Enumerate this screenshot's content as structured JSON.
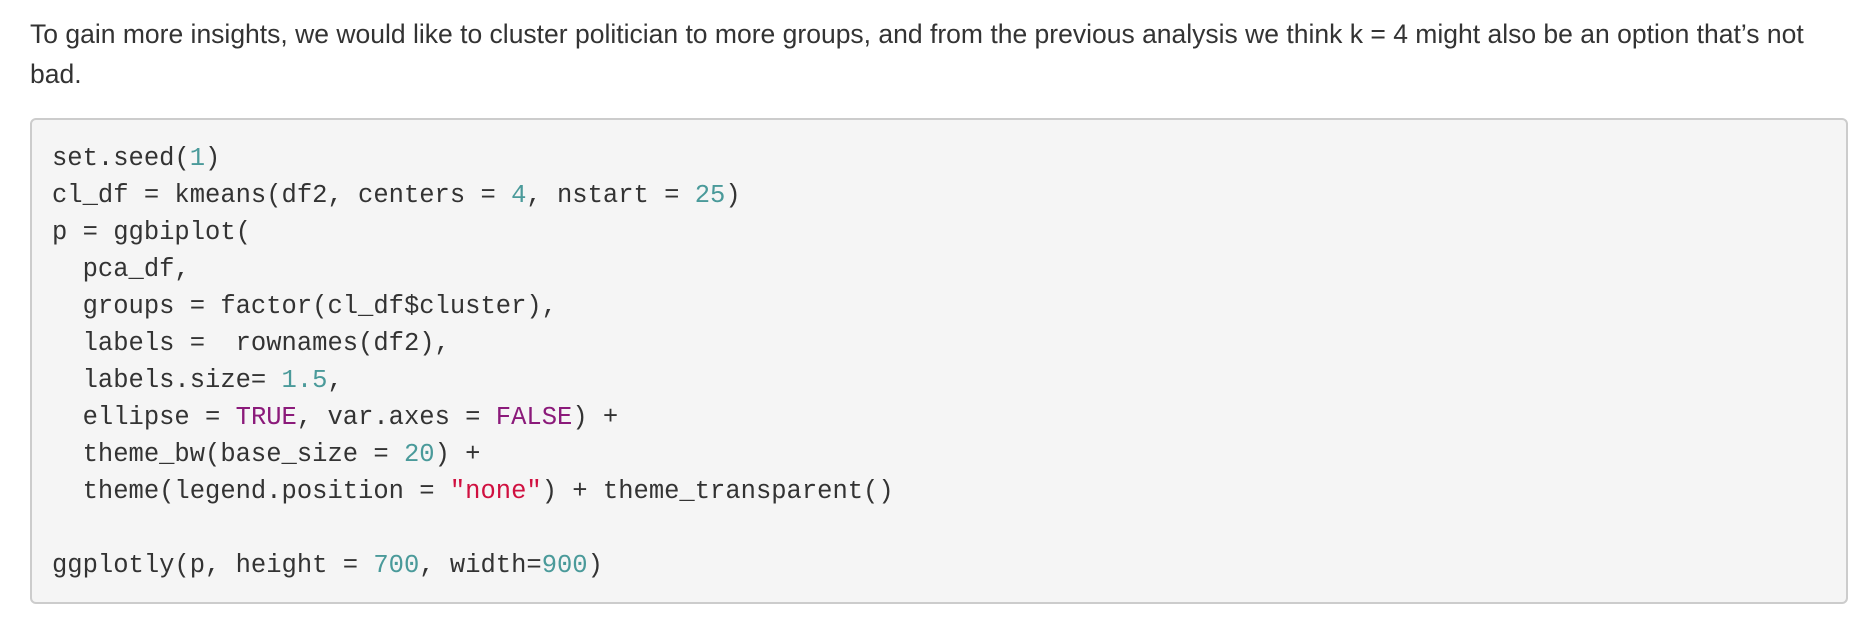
{
  "prose": {
    "text": "To gain more insights, we would like to cluster politician to more groups, and from the previous analysis we think k = 4 might also be an option that’s not bad."
  },
  "code": {
    "lines": [
      [
        {
          "t": "set.seed("
        },
        {
          "t": "1",
          "k": "num"
        },
        {
          "t": ")"
        }
      ],
      [
        {
          "t": "cl_df = kmeans(df2, centers = "
        },
        {
          "t": "4",
          "k": "num"
        },
        {
          "t": ", nstart = "
        },
        {
          "t": "25",
          "k": "num"
        },
        {
          "t": ")"
        }
      ],
      [
        {
          "t": "p = ggbiplot("
        }
      ],
      [
        {
          "t": "  pca_df,"
        }
      ],
      [
        {
          "t": "  groups = factor(cl_df$cluster),"
        }
      ],
      [
        {
          "t": "  labels =  rownames(df2),"
        }
      ],
      [
        {
          "t": "  labels.size= "
        },
        {
          "t": "1.5",
          "k": "num"
        },
        {
          "t": ","
        }
      ],
      [
        {
          "t": "  ellipse = "
        },
        {
          "t": "TRUE",
          "k": "kw"
        },
        {
          "t": ", var.axes = "
        },
        {
          "t": "FALSE",
          "k": "kw"
        },
        {
          "t": ") +"
        }
      ],
      [
        {
          "t": "  theme_bw(base_size = "
        },
        {
          "t": "20",
          "k": "num"
        },
        {
          "t": ") +"
        }
      ],
      [
        {
          "t": "  theme(legend.position = "
        },
        {
          "t": "\"none\"",
          "k": "str"
        },
        {
          "t": ") + theme_transparent()"
        }
      ],
      [
        {
          "t": ""
        }
      ],
      [
        {
          "t": "ggplotly(p, height = "
        },
        {
          "t": "700",
          "k": "num"
        },
        {
          "t": ", width="
        },
        {
          "t": "900",
          "k": "num"
        },
        {
          "t": ")"
        }
      ]
    ]
  },
  "colors": {
    "number": "#4a9a9a",
    "keyword": "#8b1a7a",
    "string": "#d01040",
    "code_background": "#f5f5f5",
    "code_border": "#cccccc"
  }
}
